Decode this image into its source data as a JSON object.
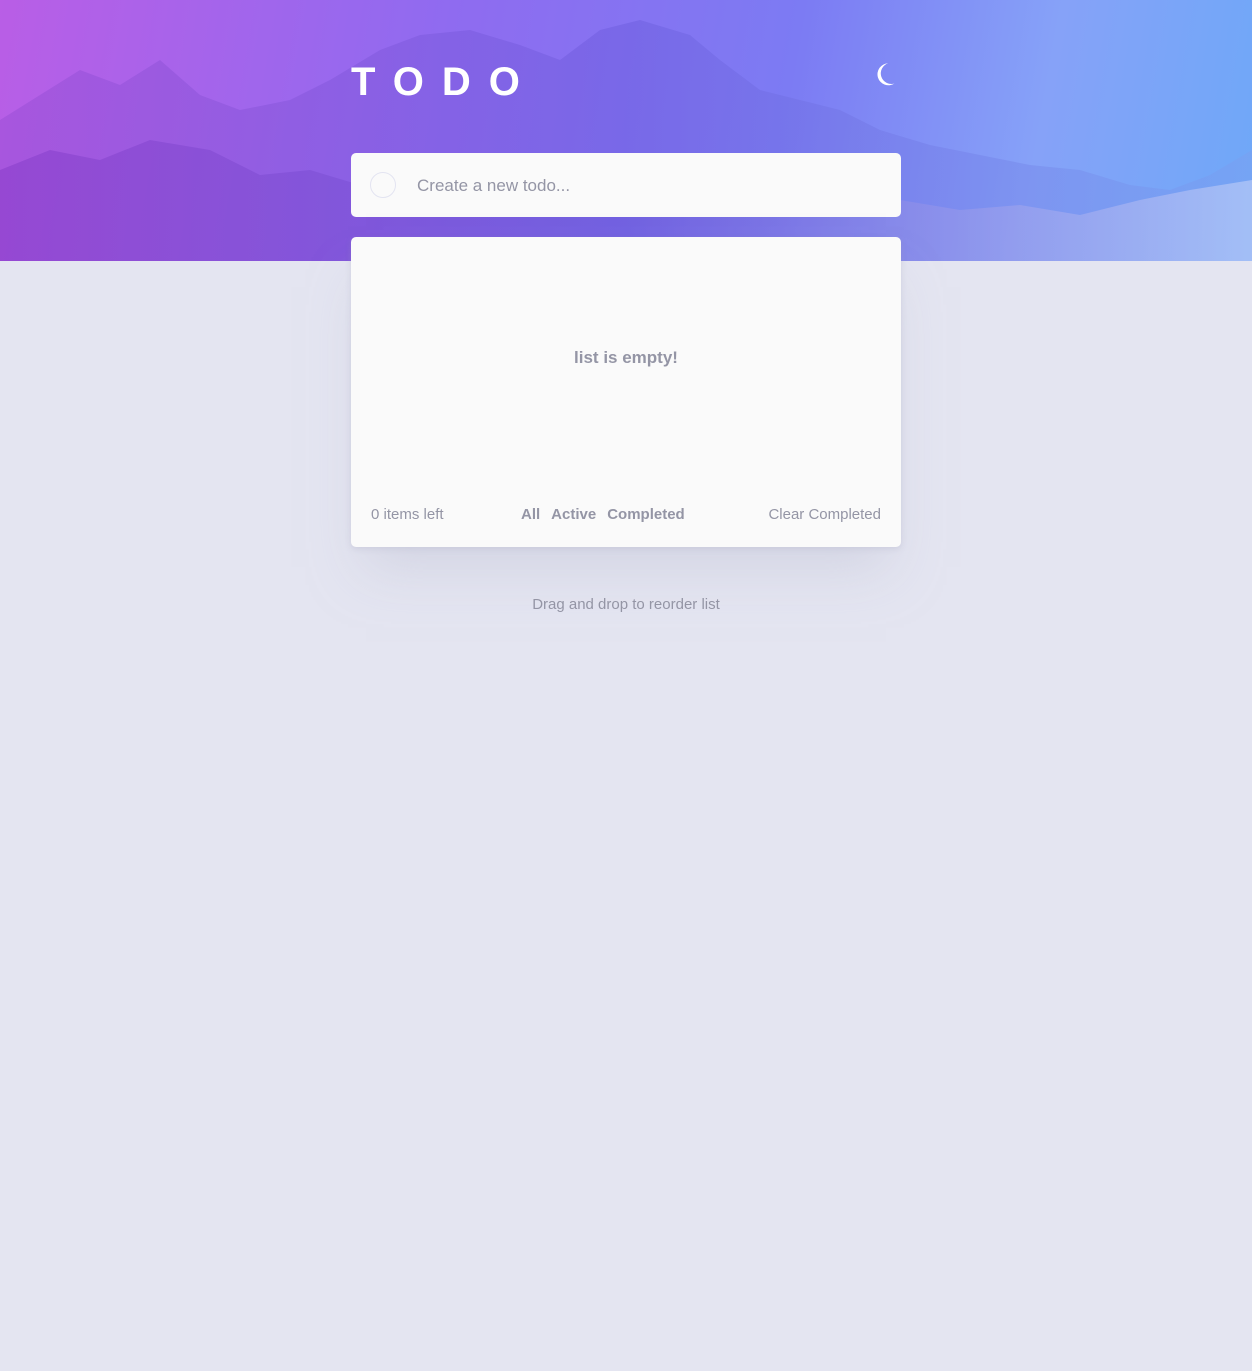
{
  "header": {
    "title": "TODO",
    "theme_toggle_icon": "moon-icon"
  },
  "new_todo": {
    "placeholder": "Create a new todo...",
    "value": ""
  },
  "list": {
    "empty_message": "list is empty!",
    "items": []
  },
  "footer": {
    "items_left": "0 items left",
    "filters": [
      "All",
      "Active",
      "Completed"
    ],
    "clear_label": "Clear Completed"
  },
  "hint": "Drag and drop to reorder list",
  "colors": {
    "background": "#e4e5f1",
    "card": "#fafafa",
    "muted_text": "#9495a5",
    "gradient_start": "#b95ee6",
    "gradient_end": "#6ea8f8"
  }
}
